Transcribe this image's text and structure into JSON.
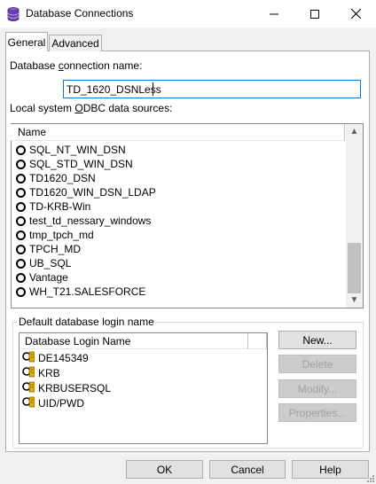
{
  "window": {
    "title": "Database Connections",
    "minimize_glyph": "—",
    "maximize_glyph": "☐",
    "close_glyph": "✕"
  },
  "tabs": [
    {
      "label": "General",
      "selected": true
    },
    {
      "label": "Advanced",
      "selected": false
    }
  ],
  "general": {
    "conn_name_label_pre": "Database ",
    "conn_name_label_ul": "c",
    "conn_name_label_post": "onnection name:",
    "conn_name_value": "TD_1620_DSNLess",
    "odbc_label_pre": "Local system ",
    "odbc_label_ul": "O",
    "odbc_label_post": "DBC data sources:",
    "odbc_column": "Name",
    "odbc_sources": [
      "SQL_NT_WIN_DSN",
      "SQL_STD_WIN_DSN",
      "TD1620_DSN",
      "TD1620_WIN_DSN_LDAP",
      "TD-KRB-Win",
      "test_td_nessary_windows",
      "tmp_tpch_md",
      "TPCH_MD",
      "UB_SQL",
      "Vantage",
      "WH_T21.SALESFORCE"
    ],
    "login_group_label": "Default database login name",
    "login_column": "Database Login Name",
    "logins": [
      "DE145349",
      "KRB",
      "KRBUSERSQL",
      "UID/PWD"
    ],
    "buttons": {
      "new": "New...",
      "delete": "Delete",
      "modify": "Modify...",
      "properties": "Properties..."
    }
  },
  "footer": {
    "ok": "OK",
    "cancel": "Cancel",
    "help": "Help"
  },
  "scroll_arrows": {
    "up": "▲",
    "down": "▼"
  },
  "colors": {
    "focus_border": "#0078d7",
    "icon_purple": "#6d3fa8",
    "icon_gold": "#e0b000"
  },
  "icons": {
    "app": "database-connections-icon",
    "radio": "radio-button-icon",
    "login": "database-login-icon"
  }
}
